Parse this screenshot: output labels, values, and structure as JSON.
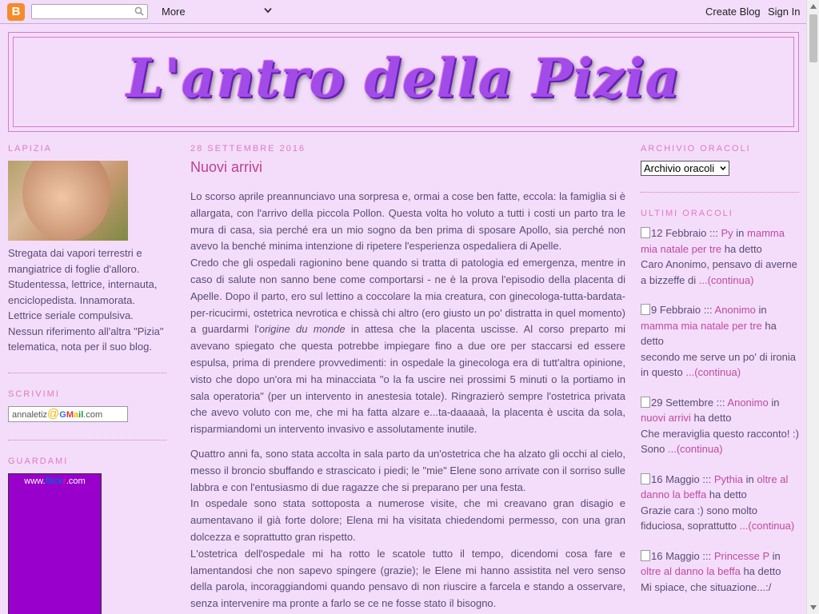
{
  "navbar": {
    "logo_letter": "B",
    "search_placeholder": "",
    "more_label": "More",
    "create_blog_label": "Create Blog",
    "sign_in_label": "Sign In"
  },
  "header": {
    "blog_title": "L'antro della Pizia"
  },
  "left": {
    "profile_title": "LAPIZIA",
    "profile_text": "Stregata dai vapori terrestri e mangiatrice di foglie d'alloro. Studentessa, lettrice, internauta, enciclopedista. Innamorata. Lettrice seriale compulsiva. Nessun riferimento all'altra \"Pizia\" telematica, nota per il suo blog.",
    "write_title": "SCRIVIMI",
    "email_prefix": "annaletiz",
    "email_at": "@",
    "email_g1": "G",
    "email_g2": "M",
    "email_g3": "a",
    "email_g4": "il",
    "email_suffix": ".com",
    "watch_title": "GUARDAMI",
    "flickr_www": "www.",
    "flickr_fl": "flick",
    "flickr_r": "r",
    "flickr_com": ".com"
  },
  "post": {
    "date": "28 SETTEMBRE 2016",
    "title": "Nuovi arrivi",
    "p1": "Lo scorso aprile preannunciavo una sorpresa e, ormai a cose ben fatte, eccola: la famiglia si è allargata, con l'arrivo della piccola Pollon. Questa volta ho voluto a tutti i costi un parto tra le mura di casa, sia perché era un mio sogno da ben prima di sposare Apollo, sia perché non avevo la benché minima intenzione di ripetere l'esperienza ospedaliera di Apelle.",
    "p2a": "Credo che gli ospedali ragionino bene quando si tratta di patologia ed emergenza, mentre in caso di salute non sanno bene come comportarsi - ne è la prova l'episodio della placenta di Apelle. Dopo il parto, ero sul lettino a coccolare la mia creatura, con ginecologa-tutta-bardata-per-ricucirmi, ostetrica nevrotica e chissà chi altro (ero giusto un po' distratta in quel momento) a guardarmi l'",
    "p2_em": "origine du monde",
    "p2b": " in attesa che la placenta uscisse. Al corso preparto mi avevano spiegato che questa potrebbe impiegare fino a due ore per staccarsi ed essere espulsa, prima di prendere provvedimenti: in ospedale la ginecologa era di tutt'altra opinione, visto che dopo un'ora mi ha minacciata \"o la fa uscire nei prossimi 5 minuti o la portiamo in sala operatoria\" (per un intervento in anestesia totale). Ringrazierò sempre l'ostetrica privata che avevo voluto con me, che mi ha fatta alzare e...ta-daaaaà, la placenta è uscita da sola, risparmiandomi un intervento invasivo e assolutamente inutile.",
    "p3": "Quattro anni fa, sono stata accolta in sala parto da un'ostetrica che ha alzato gli occhi al cielo,  messo il broncio sbuffando e strascicato i piedi; le \"mie\" Elene sono arrivate con il sorriso sulle labbra e con l'entusiasmo di due ragazze che si preparano per una festa.",
    "p4": "In ospedale sono stata sottoposta a numerose visite, che mi creavano gran disagio e aumentavano il già forte dolore; Elena mi ha visitata chiedendomi permesso, con una gran dolcezza e soprattutto gran rispetto.",
    "p5": "L'ostetrica dell'ospedale mi ha rotto le scatole tutto il tempo, dicendomi cosa fare e lamentandosi che non sapevo spingere (grazie); le Elene mi hanno assistita nel vero senso della parola, incoraggiandomi quando pensavo di non riuscire a farcela e stando a osservare, senza intervenire ma pronte a farlo se ce ne fosse stato il bisogno."
  },
  "right": {
    "archive_title": "ARCHIVIO ORACOLI",
    "archive_selected": "Archivio oracoli",
    "recent_title": "ULTIMI ORACOLI",
    "sep": ":::",
    "in_word": "in",
    "said_word": "ha detto",
    "continue_label": "...(continua)",
    "comments": [
      {
        "date": "12 Febbraio",
        "author": "Py",
        "post": "mamma mia natale per tre",
        "excerpt": "Caro Anonimo, pensavo di averne a bizzeffe di "
      },
      {
        "date": "9 Febbraio",
        "author": "Anonimo",
        "post": "mamma mia natale per tre",
        "excerpt": "secondo me serve un po' di ironia in questo "
      },
      {
        "date": "29 Settembre",
        "author": "Anonimo",
        "post": "nuovi arrivi",
        "excerpt": "Che meraviglia questo racconto! :) Sono "
      },
      {
        "date": "16 Maggio",
        "author": "Pythia",
        "post": "oltre al danno la beffa",
        "excerpt": "Grazie cara :) sono molto fiduciosa, soprattutto "
      },
      {
        "date": "16 Maggio",
        "author": "Princesse P",
        "post": "oltre al danno la beffa",
        "excerpt": "Mi spiace, che situazione...:/"
      }
    ]
  }
}
